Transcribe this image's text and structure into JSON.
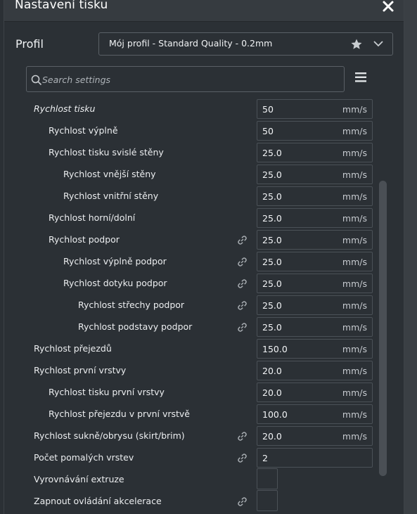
{
  "window": {
    "title": "Nastavení tisku"
  },
  "profile": {
    "label": "Profil",
    "value": "Mój profil - Standard Quality - 0.2mm"
  },
  "search": {
    "placeholder": "Search settings"
  },
  "settings": [
    {
      "label": "Rychlost tisku",
      "value": "50",
      "unit": "mm/s",
      "indent": 0,
      "italic": true,
      "link": false,
      "type": "field"
    },
    {
      "label": "Rychlost  výplně",
      "value": "50",
      "unit": "mm/s",
      "indent": 1,
      "link": false,
      "type": "field"
    },
    {
      "label": "Rychlost tisku svislé stěny",
      "value": "25.0",
      "unit": "mm/s",
      "indent": 1,
      "link": false,
      "type": "field"
    },
    {
      "label": "Rychlost vnější stěny",
      "value": "25.0",
      "unit": "mm/s",
      "indent": 2,
      "link": false,
      "type": "field"
    },
    {
      "label": "Rychlost vnitřní stěny",
      "value": "25.0",
      "unit": "mm/s",
      "indent": 2,
      "link": false,
      "type": "field"
    },
    {
      "label": "Rychlost horní/dolní",
      "value": "25.0",
      "unit": "mm/s",
      "indent": 1,
      "link": false,
      "type": "field"
    },
    {
      "label": "Rychlost podpor",
      "value": "25.0",
      "unit": "mm/s",
      "indent": 1,
      "link": true,
      "type": "field"
    },
    {
      "label": "Rychlost výplně podpor",
      "value": "25.0",
      "unit": "mm/s",
      "indent": 2,
      "link": true,
      "type": "field"
    },
    {
      "label": "Rychlost dotyku podpor",
      "value": "25.0",
      "unit": "mm/s",
      "indent": 2,
      "link": true,
      "type": "field"
    },
    {
      "label": "Rychlost střechy podpor",
      "value": "25.0",
      "unit": "mm/s",
      "indent": 3,
      "link": true,
      "type": "field"
    },
    {
      "label": "Rychlost podstavy podpor",
      "value": "25.0",
      "unit": "mm/s",
      "indent": 3,
      "link": true,
      "type": "field"
    },
    {
      "label": "Rychlost přejezdů",
      "value": "150.0",
      "unit": "mm/s",
      "indent": 0,
      "link": false,
      "type": "field"
    },
    {
      "label": "Rychlost první vrstvy",
      "value": "20.0",
      "unit": "mm/s",
      "indent": 0,
      "link": false,
      "type": "field"
    },
    {
      "label": "Rychlost tisku první vrstvy",
      "value": "20.0",
      "unit": "mm/s",
      "indent": 1,
      "link": false,
      "type": "field"
    },
    {
      "label": "Rychlost přejezdu v první vrstvě",
      "value": "100.0",
      "unit": "mm/s",
      "indent": 1,
      "link": false,
      "type": "field"
    },
    {
      "label": "Rychlost sukně/obrysu (skirt/brim)",
      "value": "20.0",
      "unit": "mm/s",
      "indent": 0,
      "link": true,
      "type": "field"
    },
    {
      "label": "Počet pomalých vrstev",
      "value": "2",
      "unit": "",
      "indent": 0,
      "link": true,
      "type": "field"
    },
    {
      "label": "Vyrovnávání extruze",
      "checked": false,
      "indent": 0,
      "link": false,
      "type": "checkbox"
    },
    {
      "label": "Zapnout ovládání akcelerace",
      "checked": false,
      "indent": 0,
      "link": true,
      "type": "checkbox"
    }
  ],
  "icons": {
    "close": "close-icon",
    "star": "star-icon",
    "dropdown": "chevron-down-icon",
    "search": "search-icon",
    "menu": "hamburger-menu-icon",
    "link": "link-icon"
  }
}
